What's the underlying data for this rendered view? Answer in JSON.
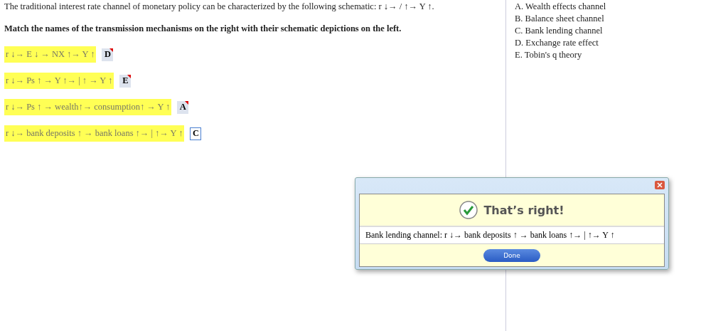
{
  "intro": "The traditional interest rate channel of monetary policy can be characterized by the following schematic: r ↓→ / ↑→ Y ↑.",
  "instruction": "Match the names of the transmission mechanisms on the right with their schematic depictions on the left.",
  "rows": [
    {
      "schematic": "r ↓→ E ↓ → NX ↑→ Y ↑",
      "answer": "D",
      "selected": false
    },
    {
      "schematic": "r ↓→ Ps ↑ → Y ↑→ | ↑ → Y ↑",
      "answer": "E",
      "selected": false
    },
    {
      "schematic": "r ↓→ Ps ↑ → wealth↑→ consumption↑ → Y ↑",
      "answer": "A",
      "selected": false
    },
    {
      "schematic": "r ↓→ bank deposits ↑ → bank loans ↑→ | ↑→ Y ↑",
      "answer": "C",
      "selected": true
    }
  ],
  "options": [
    "A. Wealth effects channel",
    "B. Balance sheet channel",
    "C. Bank lending channel",
    "D. Exchange rate effect",
    "E. Tobin's q theory"
  ],
  "dialog": {
    "title": "That’s right!",
    "message": "Bank lending channel: r ↓→ bank deposits ↑ → bank loans ↑→ | ↑→ Y ↑",
    "button": "Done"
  }
}
